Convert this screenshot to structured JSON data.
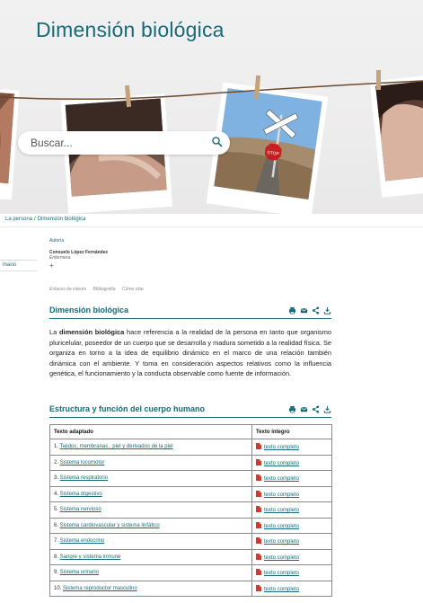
{
  "hero": {
    "title": "Dimensión biológica",
    "photo_sign_text": "STOP"
  },
  "search": {
    "placeholder": "Buscar..."
  },
  "breadcrumb": {
    "items": [
      "La persona",
      "Dimensión biológica"
    ],
    "separator": "/"
  },
  "sidebar": {
    "tab_label": "mano"
  },
  "author": {
    "heading": "Autoría",
    "name": "Consuelo López Fernández",
    "role": "Enfermera",
    "more": "+"
  },
  "subnav": {
    "items": [
      "Enlaces de interés",
      "Bibliografía",
      "Cómo citar"
    ]
  },
  "section1": {
    "title": "Dimensión biológica",
    "text_before": "La ",
    "text_bold": "dimensión biológica",
    "text_after": " hace referencia a la realidad de la persona en tanto que organismo pluricelular, poseedor de un cuerpo que se desarrolla y madura sometido a la realidad física. Se organiza en torno a la idea de equilibrio dinámico en el marco de una relación también dinámica con el ambiente. Y toma en consideración aspectos relativos como la influencia genética, el funcionamiento y la conducta observable como fuente de información."
  },
  "section2": {
    "title": "Estructura y función del cuerpo humano"
  },
  "tools": [
    "print-icon",
    "mail-icon",
    "share-icon",
    "download-icon"
  ],
  "table": {
    "headers": [
      "Texto adaptado",
      "Texto íntegro"
    ],
    "rows": [
      {
        "num": "1. ",
        "topic": "Tejidos, membranas , piel y derivados de la piel",
        "full": "texto completo"
      },
      {
        "num": "2. ",
        "topic": "Sistema locomotor",
        "full": "texto completo"
      },
      {
        "num": "3. ",
        "topic": "Sistema respiratorio",
        "full": "texto completo"
      },
      {
        "num": "4. ",
        "topic": "Sistema digestivo",
        "full": "texto completo"
      },
      {
        "num": "5. ",
        "topic": "Sistema nervioso",
        "full": "texto completo"
      },
      {
        "num": "6. ",
        "topic": "Sistema cardiovascular y sistema linfático",
        "full": "texto completo"
      },
      {
        "num": "7. ",
        "topic": "Sistema endocrino",
        "full": "texto completo"
      },
      {
        "num": "8. ",
        "topic": "Sangre y sistema inmune",
        "full": "texto completo"
      },
      {
        "num": "9. ",
        "topic": "Sistema urinario",
        "full": "texto completo"
      },
      {
        "num": "10. ",
        "topic": "Sistema reproductor masculino",
        "full": "texto completo"
      }
    ]
  },
  "colors": {
    "accent": "#176a78",
    "pdf": "#d23a2e",
    "text": "#222222"
  }
}
